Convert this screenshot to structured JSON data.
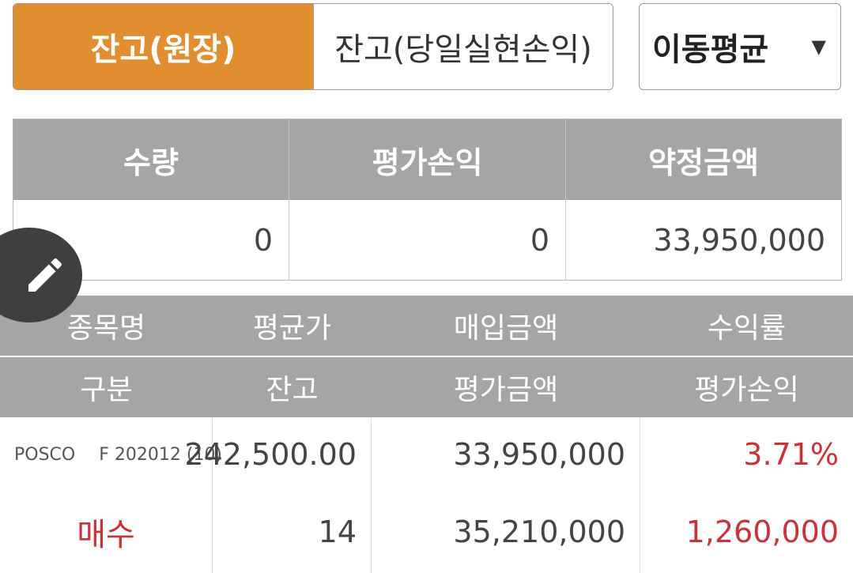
{
  "tabs": {
    "active_label": "잔고(원장)",
    "inactive_label": "잔고(당일실현손익)"
  },
  "method_select": {
    "value": "이동평균",
    "arrow": "▼"
  },
  "summary": {
    "headers": [
      "수량",
      "평가손익",
      "약정금액"
    ],
    "values": [
      "0",
      "0",
      "33,950,000"
    ]
  },
  "holdings_header": {
    "row1": [
      "종목명",
      "평균가",
      "매입금액",
      "수익률"
    ],
    "row2": [
      "구분",
      "잔고",
      "평가금액",
      "평가손익"
    ]
  },
  "holdings": [
    {
      "name": "POSCO",
      "code": "F 202012 (10)",
      "avg_price": "242,500.00",
      "buy_amount": "33,950,000",
      "return_rate": "3.71%",
      "side": "매수",
      "balance": "14",
      "eval_amount": "35,210,000",
      "eval_pnl": "1,260,000"
    }
  ],
  "fab": {
    "icon": "pencil-icon"
  },
  "colors": {
    "accent": "#e08e2f",
    "header_gray": "#a5a5a5",
    "positive_red": "#c8333a"
  }
}
